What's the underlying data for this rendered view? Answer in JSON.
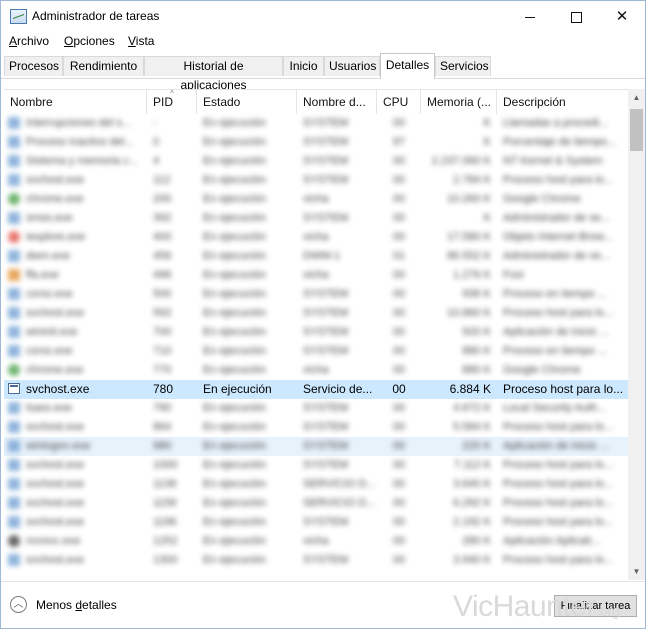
{
  "window": {
    "title": "Administrador de tareas"
  },
  "menu": [
    {
      "label": "Archivo",
      "u": "A",
      "rest": "rchivo"
    },
    {
      "label": "Opciones",
      "u": "O",
      "rest": "pciones"
    },
    {
      "label": "Vista",
      "u": "V",
      "rest": "ista"
    }
  ],
  "tabs": [
    "Procesos",
    "Rendimiento",
    "Historial de aplicaciones",
    "Inicio",
    "Usuarios",
    "Detalles",
    "Servicios"
  ],
  "active_tab": "Detalles",
  "columns": [
    "Nombre",
    "PID",
    "Estado",
    "Nombre d...",
    "CPU",
    "Memoria (...",
    "Descripción"
  ],
  "sort_indicator": "^",
  "selected_row": {
    "name": "svchost.exe",
    "pid": "780",
    "status": "En ejecución",
    "user": "Servicio de...",
    "cpu": "00",
    "memory": "6.884 K",
    "description": "Proceso host para lo..."
  },
  "blurred_rows": [
    {
      "name": "Interrupciones del s...",
      "pid": "-",
      "status": "En ejecución",
      "user": "SYSTEM",
      "cpu": "00",
      "memory": "K",
      "description": "Llamadas a procedi..."
    },
    {
      "name": "Proceso inactivo del...",
      "pid": "0",
      "status": "En ejecución",
      "user": "SYSTEM",
      "cpu": "97",
      "memory": "K",
      "description": "Porcentaje de tiempo..."
    },
    {
      "name": "Sistema y memoria c...",
      "pid": "4",
      "status": "En ejecución",
      "user": "SYSTEM",
      "cpu": "00",
      "memory": "2.237.060 K",
      "description": "NT Kernel & System"
    },
    {
      "name": "svchost.exe",
      "pid": "112",
      "status": "En ejecución",
      "user": "SYSTEM",
      "cpu": "00",
      "memory": "2.784 K",
      "description": "Proceso host para lo..."
    },
    {
      "name": "chrome.exe",
      "pid": "200",
      "status": "En ejecución",
      "user": "vicha",
      "cpu": "00",
      "memory": "10.260 K",
      "description": "Google Chrome"
    },
    {
      "name": "smss.exe",
      "pid": "392",
      "status": "En ejecución",
      "user": "SYSTEM",
      "cpu": "00",
      "memory": "K",
      "description": "Administrador de se..."
    },
    {
      "name": "iexplore.exe",
      "pid": "400",
      "status": "En ejecución",
      "user": "vicha",
      "cpu": "00",
      "memory": "17.580 K",
      "description": "Objeto Internet Brow..."
    },
    {
      "name": "dwm.exe",
      "pid": "456",
      "status": "En ejecución",
      "user": "DWM-1",
      "cpu": "01",
      "memory": "86.552 K",
      "description": "Administrador de ve..."
    },
    {
      "name": "ffa.exe",
      "pid": "496",
      "status": "En ejecución",
      "user": "vicha",
      "cpu": "00",
      "memory": "1.276 K",
      "description": "Foxi"
    },
    {
      "name": "csrss.exe",
      "pid": "500",
      "status": "En ejecución",
      "user": "SYSTEM",
      "cpu": "00",
      "memory": "936 K",
      "description": "Proceso en tiempo ..."
    },
    {
      "name": "svchost.exe",
      "pid": "592",
      "status": "En ejecución",
      "user": "SYSTEM",
      "cpu": "00",
      "memory": "10.860 K",
      "description": "Proceso host para lo..."
    },
    {
      "name": "wininit.exe",
      "pid": "700",
      "status": "En ejecución",
      "user": "SYSTEM",
      "cpu": "00",
      "memory": "920 K",
      "description": "Aplicación de inicio ..."
    },
    {
      "name": "csrss.exe",
      "pid": "710",
      "status": "En ejecución",
      "user": "SYSTEM",
      "cpu": "00",
      "memory": "880 K",
      "description": "Proceso en tiempo ..."
    },
    {
      "name": "chrome.exe",
      "pid": "770",
      "status": "En ejecución",
      "user": "vicha",
      "cpu": "00",
      "memory": "880 K",
      "description": "Google Chrome"
    },
    {
      "name": "lsass.exe",
      "pid": "790",
      "status": "En ejecución",
      "user": "SYSTEM",
      "cpu": "00",
      "memory": "4.672 K",
      "description": "Local Security Auth..."
    },
    {
      "name": "svchost.exe",
      "pid": "864",
      "status": "En ejecución",
      "user": "SYSTEM",
      "cpu": "00",
      "memory": "5.584 K",
      "description": "Proceso host para lo..."
    },
    {
      "name": "winlogon.exe",
      "pid": "980",
      "status": "En ejecución",
      "user": "SYSTEM",
      "cpu": "00",
      "memory": "220 K",
      "description": "Aplicación de inicio ..."
    },
    {
      "name": "svchost.exe",
      "pid": "1000",
      "status": "En ejecución",
      "user": "SYSTEM",
      "cpu": "00",
      "memory": "7.112 K",
      "description": "Proceso host para lo..."
    },
    {
      "name": "svchost.exe",
      "pid": "1136",
      "status": "En ejecución",
      "user": "SERVICIO D...",
      "cpu": "00",
      "memory": "3.640 K",
      "description": "Proceso host para lo..."
    },
    {
      "name": "svchost.exe",
      "pid": "1156",
      "status": "En ejecución",
      "user": "SERVICIO D...",
      "cpu": "00",
      "memory": "6.292 K",
      "description": "Proceso host para lo..."
    },
    {
      "name": "svchost.exe",
      "pid": "1196",
      "status": "En ejecución",
      "user": "SYSTEM",
      "cpu": "00",
      "memory": "2.192 K",
      "description": "Proceso host para lo..."
    },
    {
      "name": "nvvsvc.exe",
      "pid": "1252",
      "status": "En ejecución",
      "user": "vicha",
      "cpu": "00",
      "memory": "280 K",
      "description": "Aplicación Aplicati..."
    },
    {
      "name": "svchost.exe",
      "pid": "1300",
      "status": "En ejecución",
      "user": "SYSTEM",
      "cpu": "00",
      "memory": "3.940 K",
      "description": "Proceso host para lo..."
    }
  ],
  "footer": {
    "fewer_details": "Menos detalles",
    "fewer_underline_prefix": "Menos ",
    "fewer_underline": "d",
    "fewer_suffix": "etalles",
    "end_task": "Finalizar tarea"
  },
  "watermark": {
    "main": "VicHaunter",
    "suffix": ".org"
  }
}
